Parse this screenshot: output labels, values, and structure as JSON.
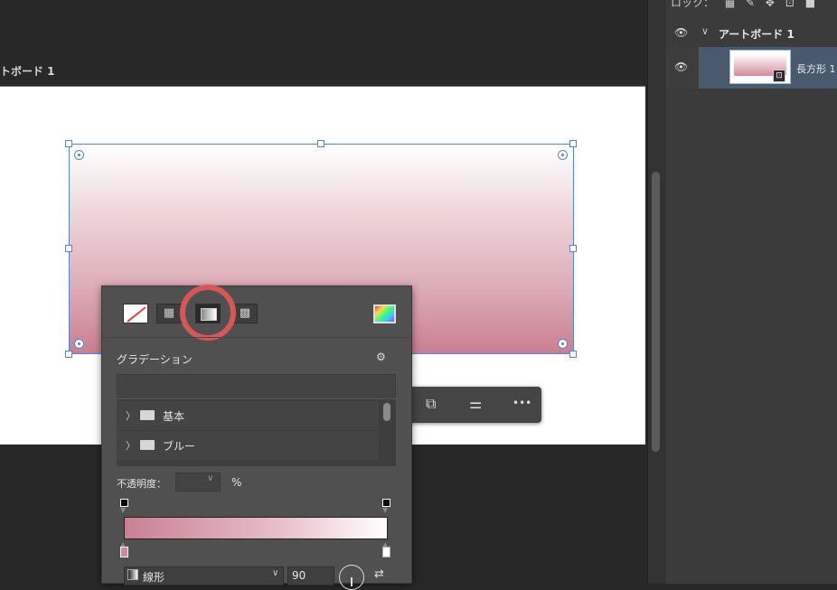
{
  "canvas": {
    "artboard_label": "トボード 1"
  },
  "layers": {
    "lock_label": "ロック：",
    "artboard_name": "アートボード 1",
    "layer_name": "長方形 1",
    "chevron": "∨"
  },
  "context_toolbar": {
    "icons": [
      "duplicate-icon",
      "adjust-icon",
      "more-icon"
    ],
    "more_glyph": "•••"
  },
  "fill_popover": {
    "fill_types": [
      "none",
      "solid",
      "gradient",
      "pattern"
    ],
    "selected_type": "gradient",
    "section_title": "グラデーション",
    "gear_glyph": "⚙",
    "presets": [
      "基本",
      "ブルー"
    ],
    "opacity_label": "不透明度：",
    "opacity_value": "",
    "percent_sign": "%",
    "gradient_type": "線形",
    "angle": "90"
  },
  "colors": {
    "selection": "#4f86d9",
    "gradient_start": "#c98092",
    "gradient_end": "#ffffff",
    "highlight_ring": "#d75757",
    "layer_selected": "#4a5a6e"
  }
}
